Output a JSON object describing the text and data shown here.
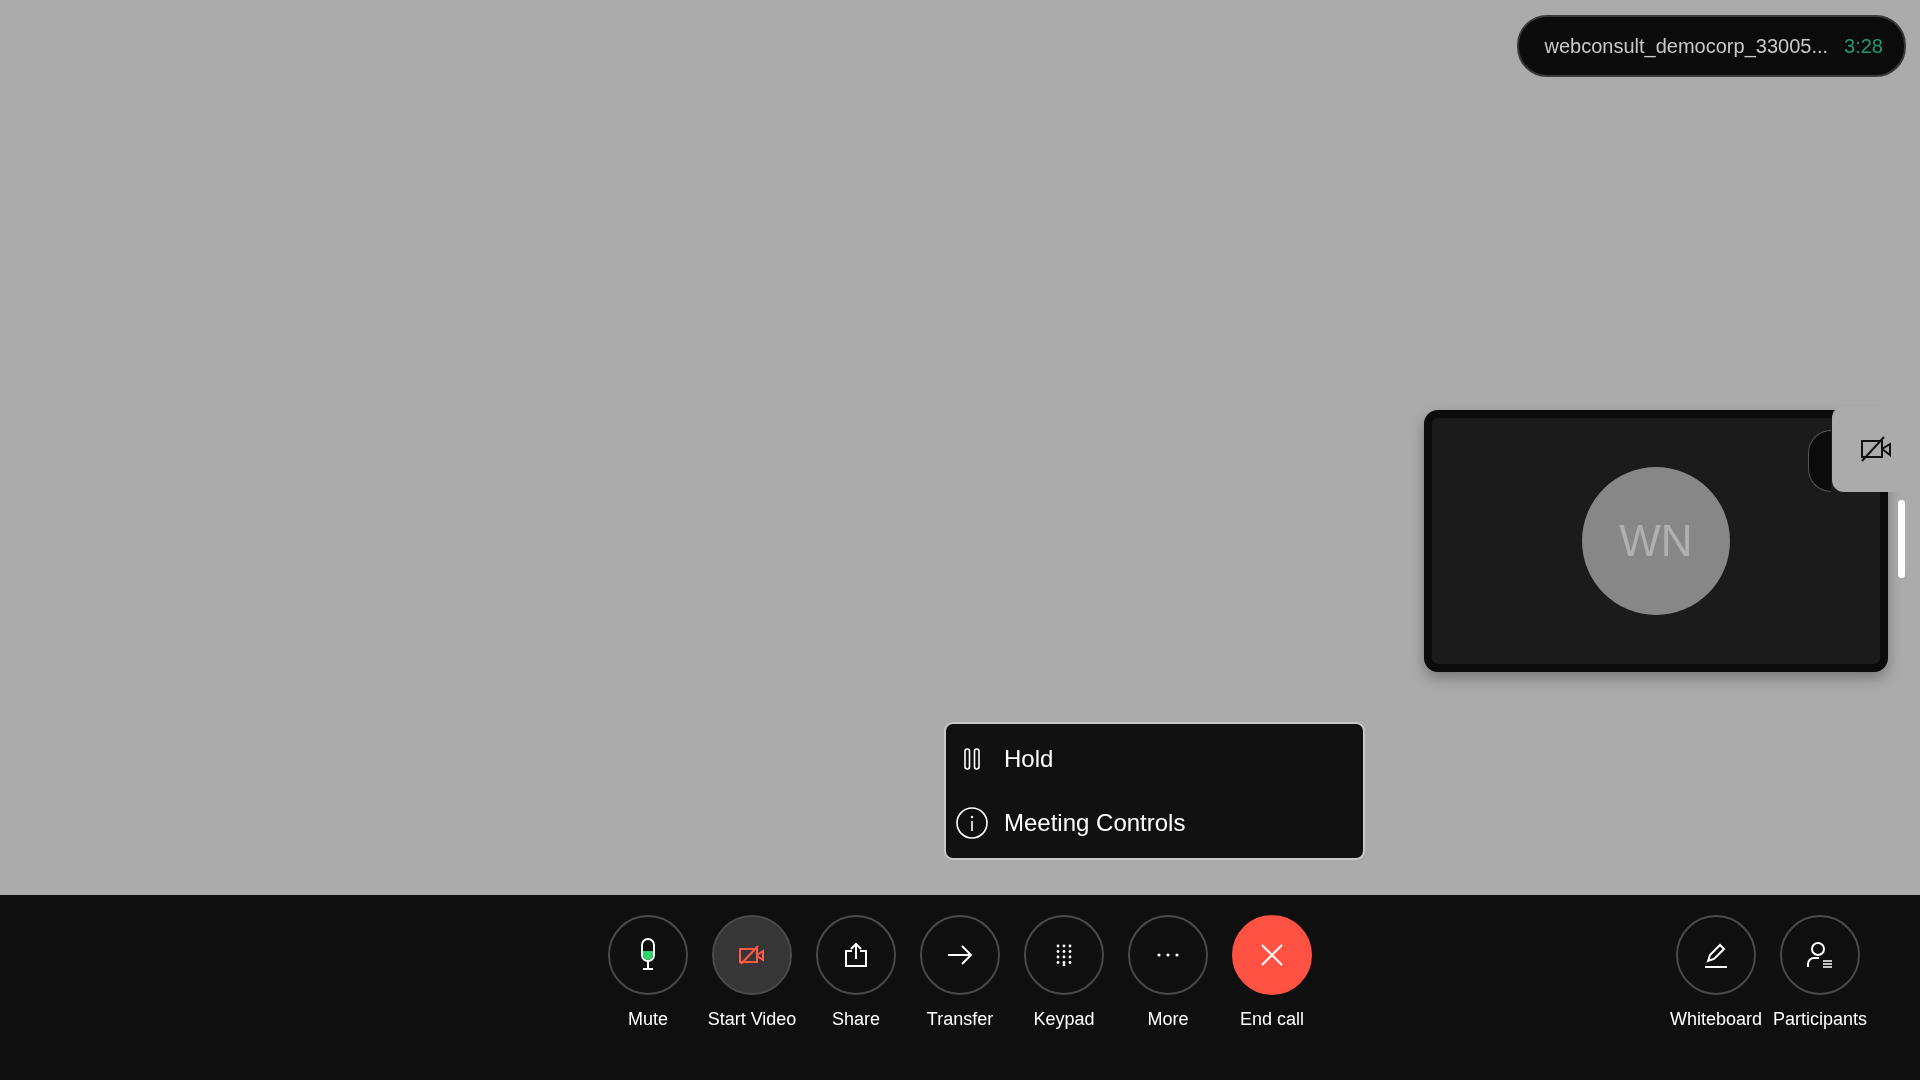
{
  "meeting": {
    "title": "webconsult_democorp_33005...",
    "duration": "3:28"
  },
  "self_view": {
    "initials": "WN",
    "video_on": false
  },
  "menu": [
    {
      "kind": "hold",
      "label": "Hold"
    },
    {
      "kind": "info",
      "label": "Meeting Controls"
    }
  ],
  "controls": [
    {
      "kind": "mic",
      "label": "Mute",
      "highlighted": false
    },
    {
      "kind": "video",
      "label": "Start Video",
      "highlighted": true
    },
    {
      "kind": "share",
      "label": "Share",
      "highlighted": false
    },
    {
      "kind": "transfer",
      "label": "Transfer",
      "highlighted": false
    },
    {
      "kind": "keypad",
      "label": "Keypad",
      "highlighted": false
    },
    {
      "kind": "more",
      "label": "More",
      "highlighted": false
    },
    {
      "kind": "end",
      "label": "End call",
      "highlighted": false
    }
  ],
  "side_controls": [
    {
      "kind": "whiteboard",
      "label": "Whiteboard"
    },
    {
      "kind": "participants",
      "label": "Participants"
    }
  ]
}
